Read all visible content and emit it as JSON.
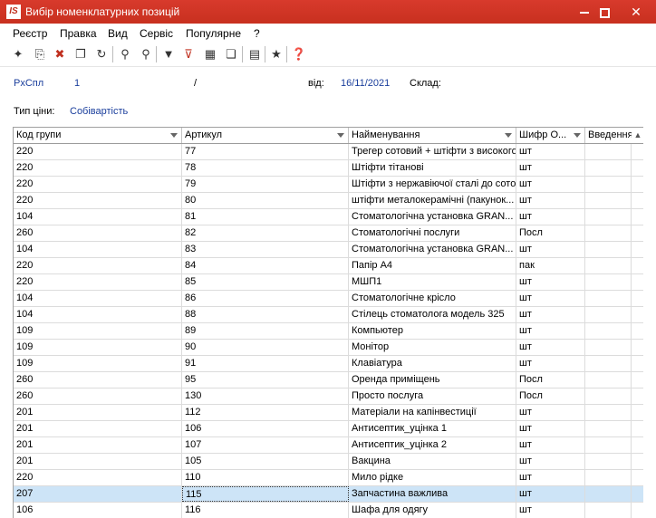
{
  "window": {
    "logo": "IS",
    "title": "Вибір номенклатурних позицій"
  },
  "menu": [
    "Реєстр",
    "Правка",
    "Вид",
    "Сервіс",
    "Популярне",
    "?"
  ],
  "toolbar_icons": [
    "new-doc-icon",
    "copy-doc-icon",
    "delete-doc-icon",
    "duplicate-icon",
    "refresh-icon",
    "find-icon",
    "find-next-icon",
    "filter-icon",
    "clear-filter-icon",
    "table-icon",
    "export-icon",
    "report-icon",
    "favorite-icon",
    "help-icon"
  ],
  "header": {
    "doc_type": "РхСпл",
    "doc_number": "1",
    "slash": "/",
    "date_label": "від:",
    "date_value": "16/11/2021",
    "warehouse_label": "Склад:",
    "price_type_label": "Тип ціни:",
    "price_type_value": "Собівартість"
  },
  "grid": {
    "columns": [
      "Код групи",
      "Артикул",
      "Найменування",
      "Шифр О...",
      "Введення"
    ],
    "rows": [
      [
        "220",
        "77",
        "Трегер сотовий + штіфти з високого...",
        "шт",
        ""
      ],
      [
        "220",
        "78",
        "Штіфти тітанові",
        "шт",
        ""
      ],
      [
        "220",
        "79",
        "Штіфти з нержавіючої сталі до сотового...",
        "шт",
        ""
      ],
      [
        "220",
        "80",
        "штіфти металокерамічні (пакунок...",
        "шт",
        ""
      ],
      [
        "104",
        "81",
        "Стоматологічна установка GRAN...",
        "шт",
        ""
      ],
      [
        "260",
        "82",
        "Стоматологічні послуги",
        "Посл",
        ""
      ],
      [
        "104",
        "83",
        "Стоматологічна установка GRAN...",
        "шт",
        ""
      ],
      [
        "220",
        "84",
        "Папір А4",
        "пак",
        ""
      ],
      [
        "220",
        "85",
        "МШП1",
        "шт",
        ""
      ],
      [
        "104",
        "86",
        "Стоматологічне крісло",
        "шт",
        ""
      ],
      [
        "104",
        "88",
        "Стілець стоматолога модель 325",
        "шт",
        ""
      ],
      [
        "109",
        "89",
        "Компьютер",
        "шт",
        ""
      ],
      [
        "109",
        "90",
        "Монітор",
        "шт",
        ""
      ],
      [
        "109",
        "91",
        "Клавіатура",
        "шт",
        ""
      ],
      [
        "260",
        "95",
        "Оренда приміщень",
        "Посл",
        ""
      ],
      [
        "260",
        "130",
        "Просто послуга",
        "Посл",
        ""
      ],
      [
        "201",
        "112",
        "Матеріали на капінвестиції",
        "шт",
        ""
      ],
      [
        "201",
        "106",
        "Антисептик_уцінка 1",
        "шт",
        ""
      ],
      [
        "201",
        "107",
        "Антисептик_уцінка 2",
        "шт",
        ""
      ],
      [
        "201",
        "105",
        "Вакцина",
        "шт",
        ""
      ],
      [
        "220",
        "110",
        "Мило рідке",
        "шт",
        ""
      ],
      [
        "207",
        "115",
        "Запчастина важлива",
        "шт",
        ""
      ],
      [
        "106",
        "116",
        "Шафа для одягу",
        "шт",
        ""
      ]
    ],
    "selected_row": 21
  }
}
